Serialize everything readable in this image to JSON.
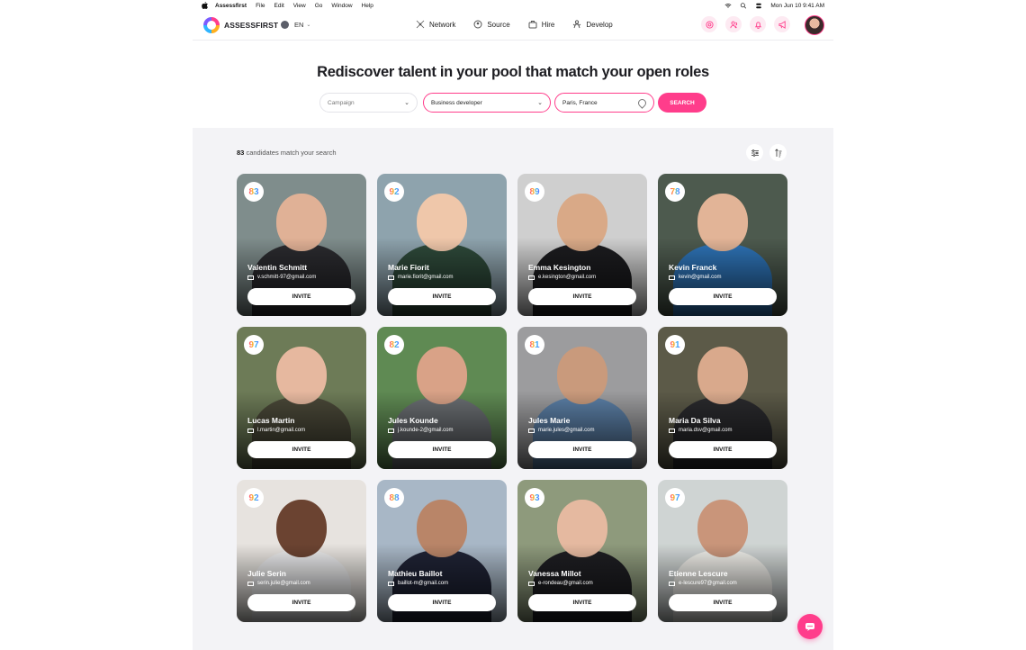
{
  "menubar": {
    "app": "Assessfirst",
    "items": [
      "File",
      "Edit",
      "View",
      "Go",
      "Window",
      "Help"
    ],
    "clock": "Mon Jun 10  9:41 AM"
  },
  "header": {
    "brand": "ASSESSFIRST",
    "language": "EN",
    "nav": [
      {
        "label": "Network",
        "icon": "network-icon"
      },
      {
        "label": "Source",
        "icon": "source-icon"
      },
      {
        "label": "Hire",
        "icon": "briefcase-icon"
      },
      {
        "label": "Develop",
        "icon": "develop-icon"
      }
    ],
    "action_icons": [
      "target-icon",
      "people-icon",
      "bell-icon",
      "megaphone-icon"
    ]
  },
  "page": {
    "title": "Rediscover talent in your pool that match your open roles"
  },
  "search": {
    "campaign_placeholder": "Campaign",
    "role_value": "Business developer",
    "location_value": "Paris, France",
    "button_label": "SEARCH"
  },
  "results": {
    "count": "83",
    "count_suffix": "candidates match your search",
    "invite_label": "INVITE"
  },
  "candidates": [
    {
      "name": "Valentin Schmitt",
      "email": "v.schmitt-97@gmail.com",
      "score": "83",
      "bg": "#7f8d8c",
      "skin": "#e0b196",
      "top": "#2b2b2f"
    },
    {
      "name": "Marie Fiorit",
      "email": "marie.fiorit@gmail.com",
      "score": "92",
      "bg": "#8ea3ad",
      "skin": "#efc7aa",
      "top": "#2e4a3a"
    },
    {
      "name": "Emma Kesington",
      "email": "e.kesington@gmail.com",
      "score": "89",
      "bg": "#cfcfcf",
      "skin": "#d9a987",
      "top": "#1c1c1f"
    },
    {
      "name": "Kevin Franck",
      "email": "kevin@gmail.com",
      "score": "78",
      "bg": "#4d5a4e",
      "skin": "#e2b497",
      "top": "#2e74b8"
    },
    {
      "name": "Lucas Martin",
      "email": "l.martin@gmail.com",
      "score": "97",
      "bg": "#6d7b57",
      "skin": "#e6b89f",
      "top": "#4a4838"
    },
    {
      "name": "Jules Kounde",
      "email": "j.kounde-2@gmail.com",
      "score": "82",
      "bg": "#5f8a53",
      "skin": "#d9a287",
      "top": "#6a6e72"
    },
    {
      "name": "Jules Marie",
      "email": "marie.jules@gmail.com",
      "score": "81",
      "bg": "#9c9c9e",
      "skin": "#c99a7c",
      "top": "#5b7fa6"
    },
    {
      "name": "Maria Da Silva",
      "email": "maria.dsv@gmail.com",
      "score": "91",
      "bg": "#5c5a48",
      "skin": "#d9a98c",
      "top": "#2a2a2d"
    },
    {
      "name": "Julie Serin",
      "email": "serin.julie@gmail.com",
      "score": "92",
      "bg": "#e7e3df",
      "skin": "#6b4331",
      "top": "#e9e9ea"
    },
    {
      "name": "Mathieu Baillot",
      "email": "baillot-m@gmail.com",
      "score": "88",
      "bg": "#a8b7c6",
      "skin": "#b98568",
      "top": "#1f2335"
    },
    {
      "name": "Vanessa Millot",
      "email": "e-rondeau@gmail.com",
      "score": "93",
      "bg": "#8e9a7c",
      "skin": "#e5b9a0",
      "top": "#1e1e22"
    },
    {
      "name": "Etienne Lescure",
      "email": "e-lescure97@gmail.com",
      "score": "97",
      "bg": "#cfd4d3",
      "skin": "#c9957a",
      "top": "#efeee9"
    }
  ]
}
